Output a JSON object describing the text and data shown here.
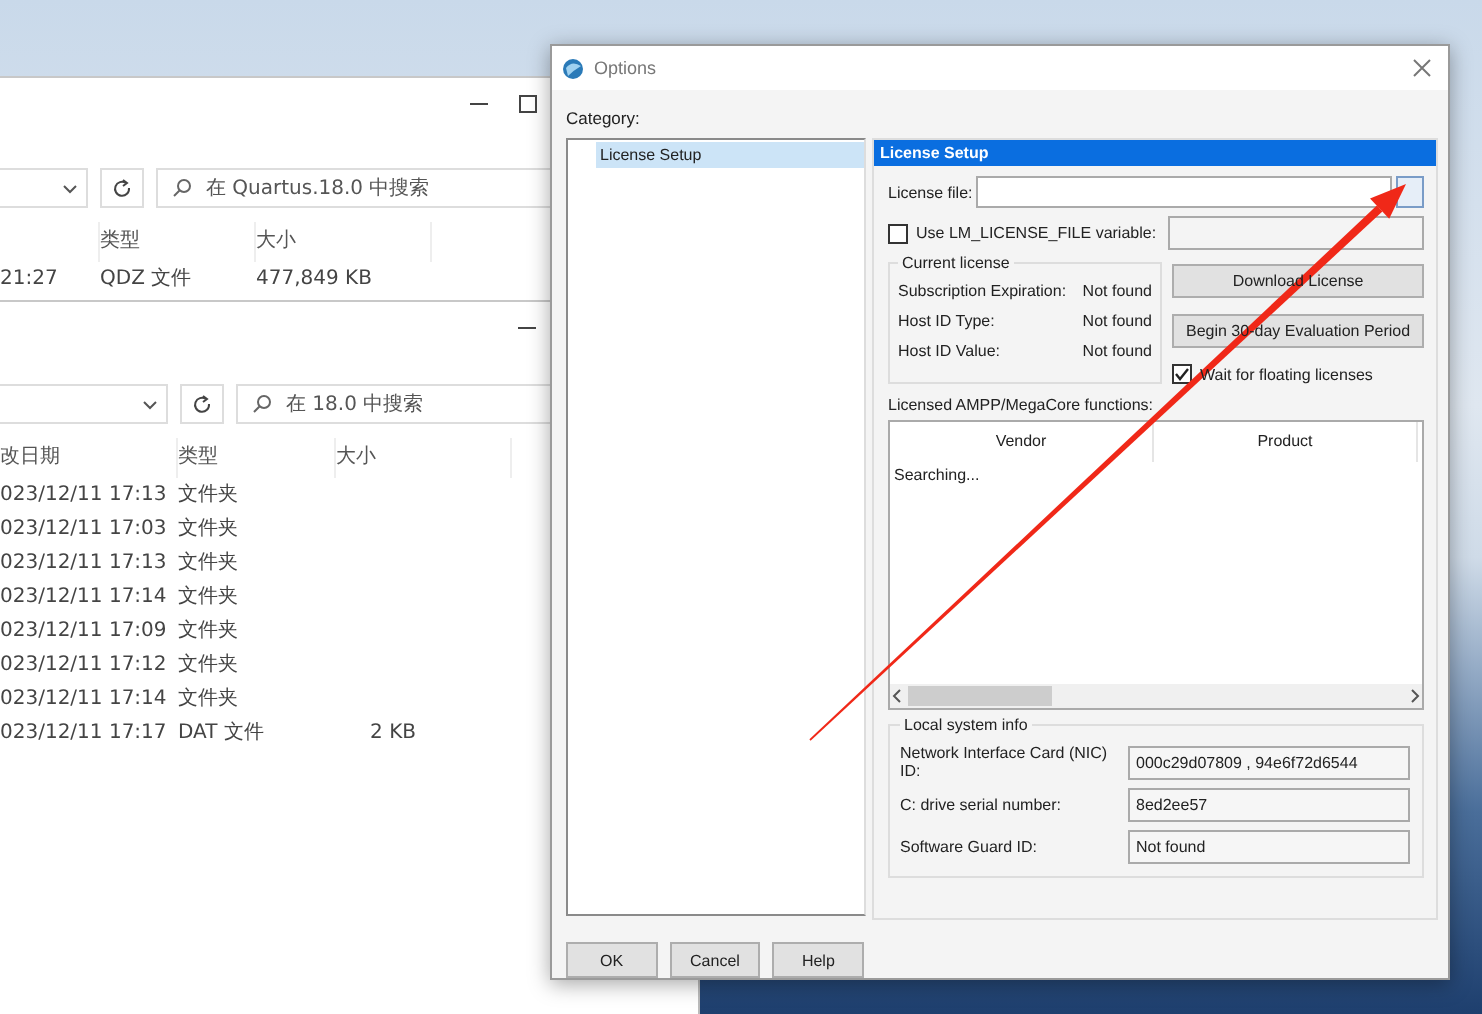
{
  "explorer_windows": [
    {
      "search": {
        "placeholder": "在 Quartus.18.0 中搜索"
      },
      "columns": [
        {
          "kind": "type",
          "label": "类型"
        },
        {
          "kind": "size",
          "label": "大小"
        }
      ],
      "rows": [
        {
          "date": "21:27",
          "type": "QDZ 文件",
          "size": "477,849 KB"
        }
      ]
    },
    {
      "search": {
        "placeholder": "在 18.0 中搜索"
      },
      "columns": [
        {
          "kind": "date",
          "label": "改日期"
        },
        {
          "kind": "type",
          "label": "类型"
        },
        {
          "kind": "size",
          "label": "大小"
        }
      ],
      "rows": [
        {
          "date": "023/12/11 17:13",
          "type": "文件夹"
        },
        {
          "date": "023/12/11 17:03",
          "type": "文件夹"
        },
        {
          "date": "023/12/11 17:13",
          "type": "文件夹"
        },
        {
          "date": "023/12/11 17:14",
          "type": "文件夹"
        },
        {
          "date": "023/12/11 17:09",
          "type": "文件夹"
        },
        {
          "date": "023/12/11 17:12",
          "type": "文件夹"
        },
        {
          "date": "023/12/11 17:14",
          "type": "文件夹"
        },
        {
          "date": "023/12/11 17:17",
          "type": "DAT 文件",
          "size": "2 KB"
        }
      ]
    }
  ],
  "dialog": {
    "title": "Options",
    "category_label": "Category:",
    "categories": [
      {
        "label": "License Setup",
        "selected": true
      }
    ],
    "panel": {
      "title": "License Setup",
      "license_file": {
        "label": "License file:"
      },
      "use_env": {
        "label": "Use LM_LICENSE_FILE variable:",
        "checked": false
      },
      "current_license": {
        "title": "Current license",
        "fields": [
          {
            "label": "Subscription Expiration:",
            "value": "Not found"
          },
          {
            "label": "Host ID Type:",
            "value": "Not found"
          },
          {
            "label": "Host ID Value:",
            "value": "Not found"
          }
        ]
      },
      "side_buttons": [
        "Download License",
        "Begin 30-day Evaluation Period"
      ],
      "wait_floating": {
        "label": "Wait for floating licenses",
        "checked": true
      },
      "functions": {
        "label": "Licensed AMPP/MegaCore functions:",
        "columns": [
          "Vendor",
          "Product"
        ],
        "status": "Searching..."
      },
      "local_info": {
        "title": "Local system info",
        "fields": [
          {
            "label": "Network Interface Card (NIC) ID:",
            "value": "000c29d07809 , 94e6f72d6544"
          },
          {
            "label": "C: drive serial number:",
            "value": "8ed2ee57"
          },
          {
            "label": "Software Guard ID:",
            "value": "Not found"
          }
        ]
      }
    },
    "buttons": [
      "OK",
      "Cancel",
      "Help"
    ]
  }
}
